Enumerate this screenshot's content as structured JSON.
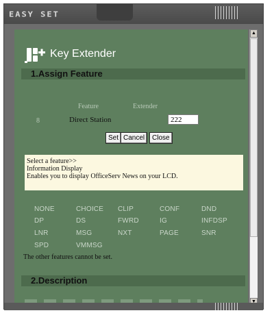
{
  "window": {
    "title": "EASY SET"
  },
  "app": {
    "title": "Key Extender",
    "logo_icon": "key-extender-logo-icon"
  },
  "section1": {
    "title": "1.Assign Feature"
  },
  "table": {
    "col_feature": "Feature",
    "col_extender": "Extender",
    "row_number": "8",
    "row_feature": "Direct Station",
    "row_extender_value": "222"
  },
  "buttons": {
    "set": "Set",
    "cancel": "Cancel",
    "close": "Close"
  },
  "info": {
    "line1": "Select a feature>>",
    "line2": "Information Display",
    "line3": "Enables you to display OfficeServ News on your LCD."
  },
  "features": [
    [
      "NONE",
      "CHOICE",
      "CLIP",
      "CONF",
      "DND"
    ],
    [
      "DP",
      "DS",
      "FWRD",
      "IG",
      "INFDSP"
    ],
    [
      "LNR",
      "MSG",
      "NXT",
      "PAGE",
      "SNR"
    ],
    [
      "SPD",
      "VMMSG"
    ]
  ],
  "note": "The other features cannot be set.",
  "section2": {
    "title": "2.Description"
  },
  "colors": {
    "panel": "#5e7f5e",
    "section_bar": "#4d6b4d",
    "info_bg": "#fcf8e0",
    "frame": "#6d6d6d"
  }
}
